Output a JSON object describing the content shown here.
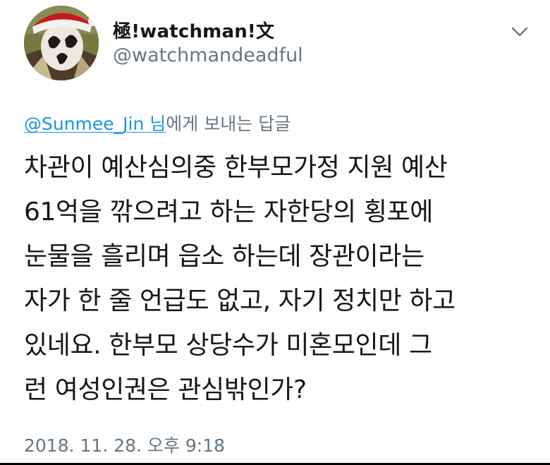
{
  "author": {
    "display_name": "極!watchman!文",
    "handle": "@watchmandeadful",
    "avatar_description": "masked-figure-santa-hat"
  },
  "menu": {
    "icon": "chevron-down-icon"
  },
  "reply_context": {
    "mention": "@Sunmee_Jin 님",
    "suffix": "에게 보내는 답글"
  },
  "tweet": {
    "lines": [
      "차관이 예산심의중 한부모가정 지원 예산",
      "61억을 깎으려고 하는 자한당의 횡포에",
      "눈물을 흘리며 읍소 하는데 장관이라는",
      "자가 한 줄 언급도 없고, 자기 정치만 하고",
      "있네요. 한부모 상당수가 미혼모인데 그",
      "런 여성인권은 관심밖인가?"
    ],
    "timestamp": "2018. 11. 28. 오후 9:18"
  },
  "colors": {
    "text_primary": "#14171a",
    "text_secondary": "#657786",
    "link": "#1b95e0",
    "background": "#ffffff"
  }
}
